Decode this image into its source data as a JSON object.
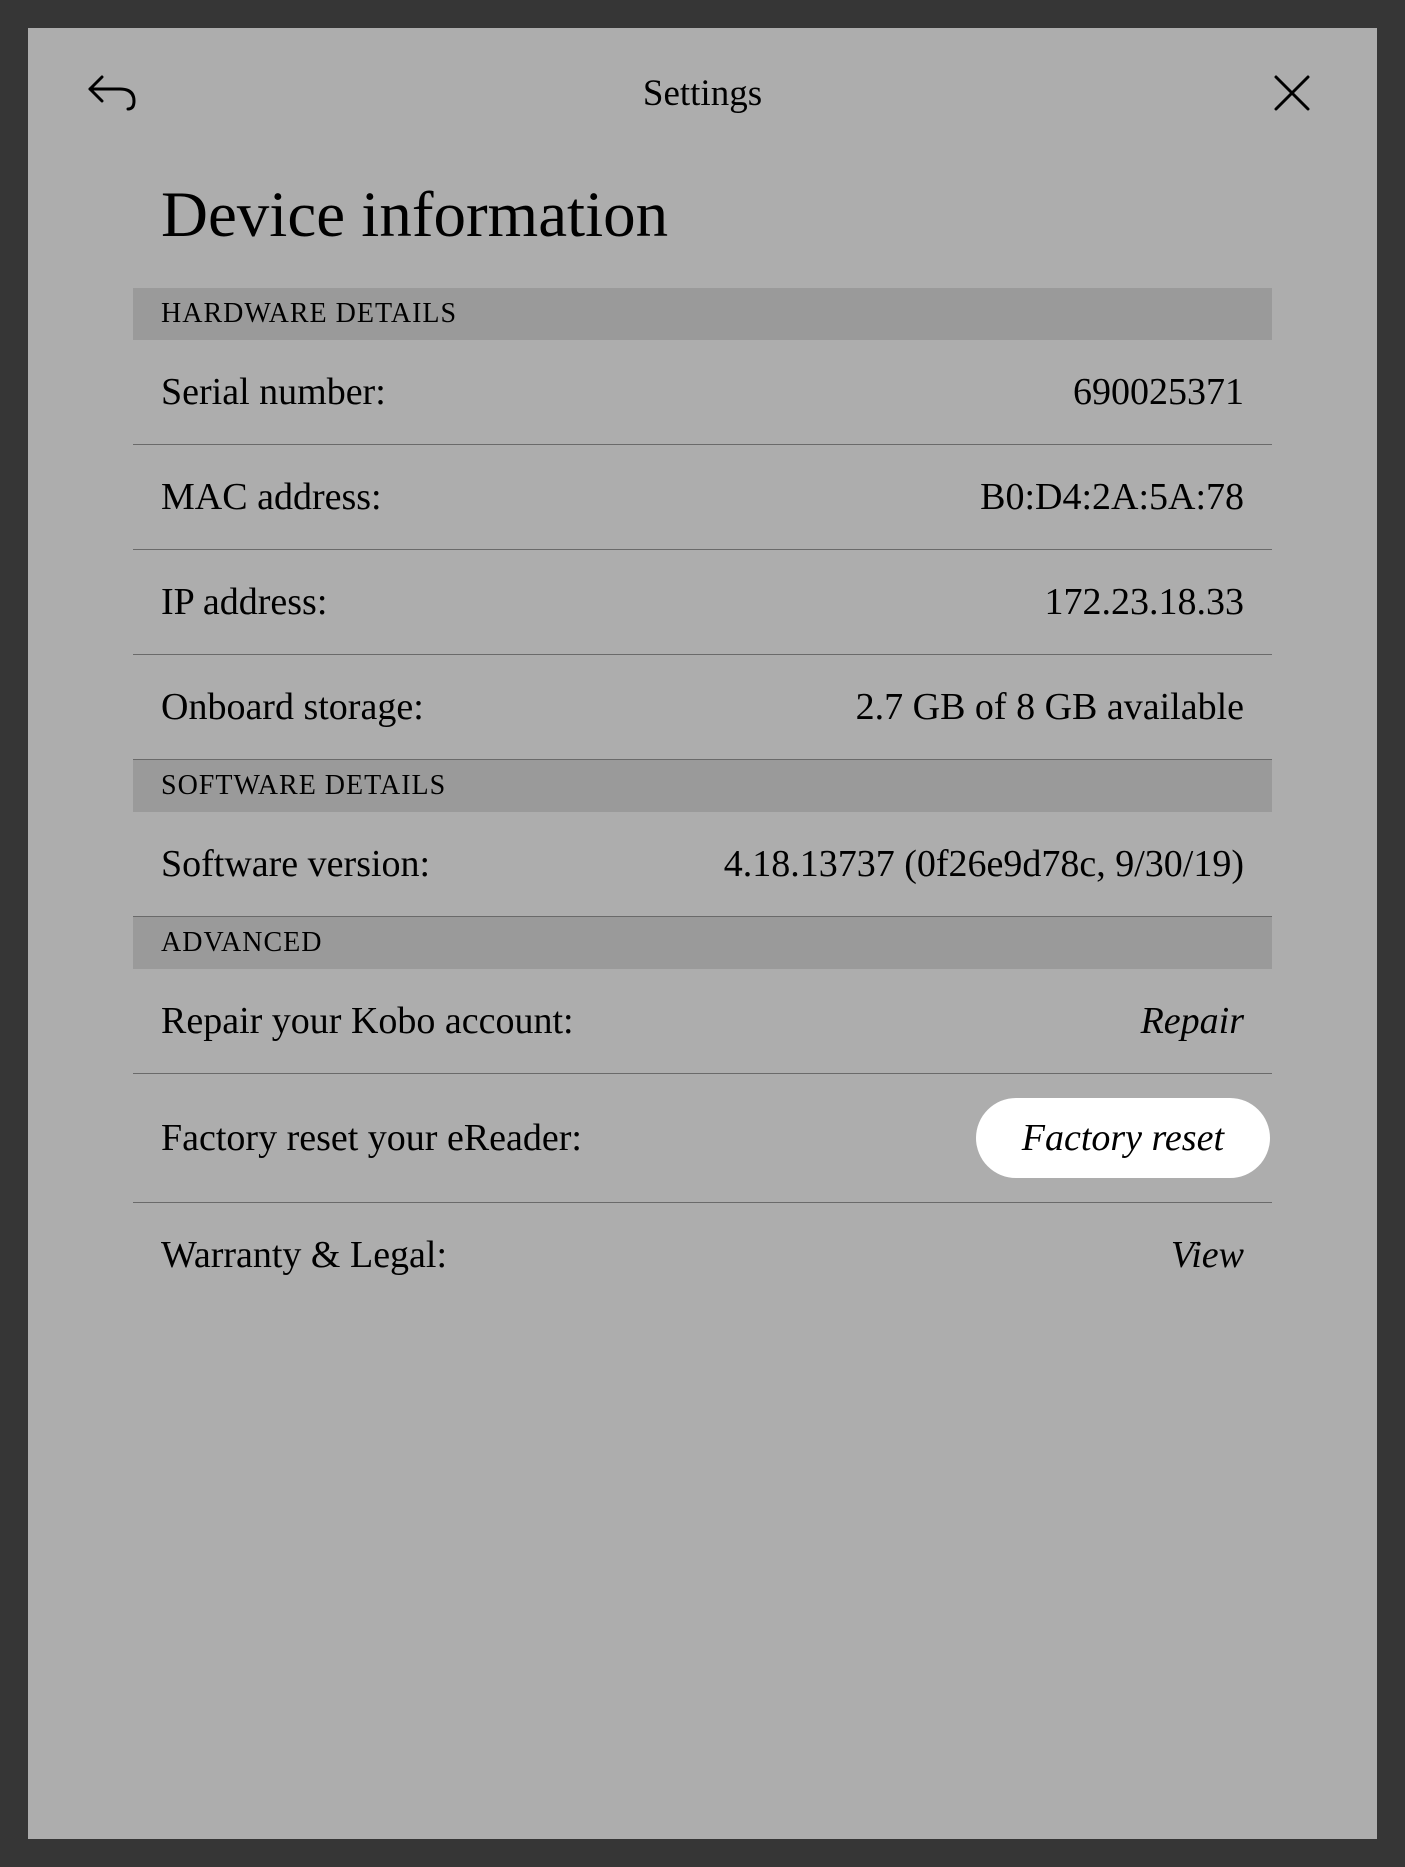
{
  "header": {
    "title": "Settings"
  },
  "page": {
    "title": "Device information"
  },
  "sections": {
    "hardware": {
      "header": "HARDWARE DETAILS",
      "serial": {
        "label": "Serial number:",
        "value": "690025371"
      },
      "mac": {
        "label": "MAC address:",
        "value": "B0:D4:2A:5A:78"
      },
      "ip": {
        "label": "IP address:",
        "value": "172.23.18.33"
      },
      "storage": {
        "label": "Onboard storage:",
        "value": "2.7 GB of 8 GB available"
      }
    },
    "software": {
      "header": "SOFTWARE DETAILS",
      "version": {
        "label": "Software version:",
        "value": "4.18.13737 (0f26e9d78c, 9/30/19)"
      }
    },
    "advanced": {
      "header": "ADVANCED",
      "repair": {
        "label": "Repair your Kobo account:",
        "action": "Repair"
      },
      "factory": {
        "label": "Factory reset your eReader:",
        "action": "Factory reset"
      },
      "warranty": {
        "label": "Warranty & Legal:",
        "action": "View"
      }
    }
  }
}
